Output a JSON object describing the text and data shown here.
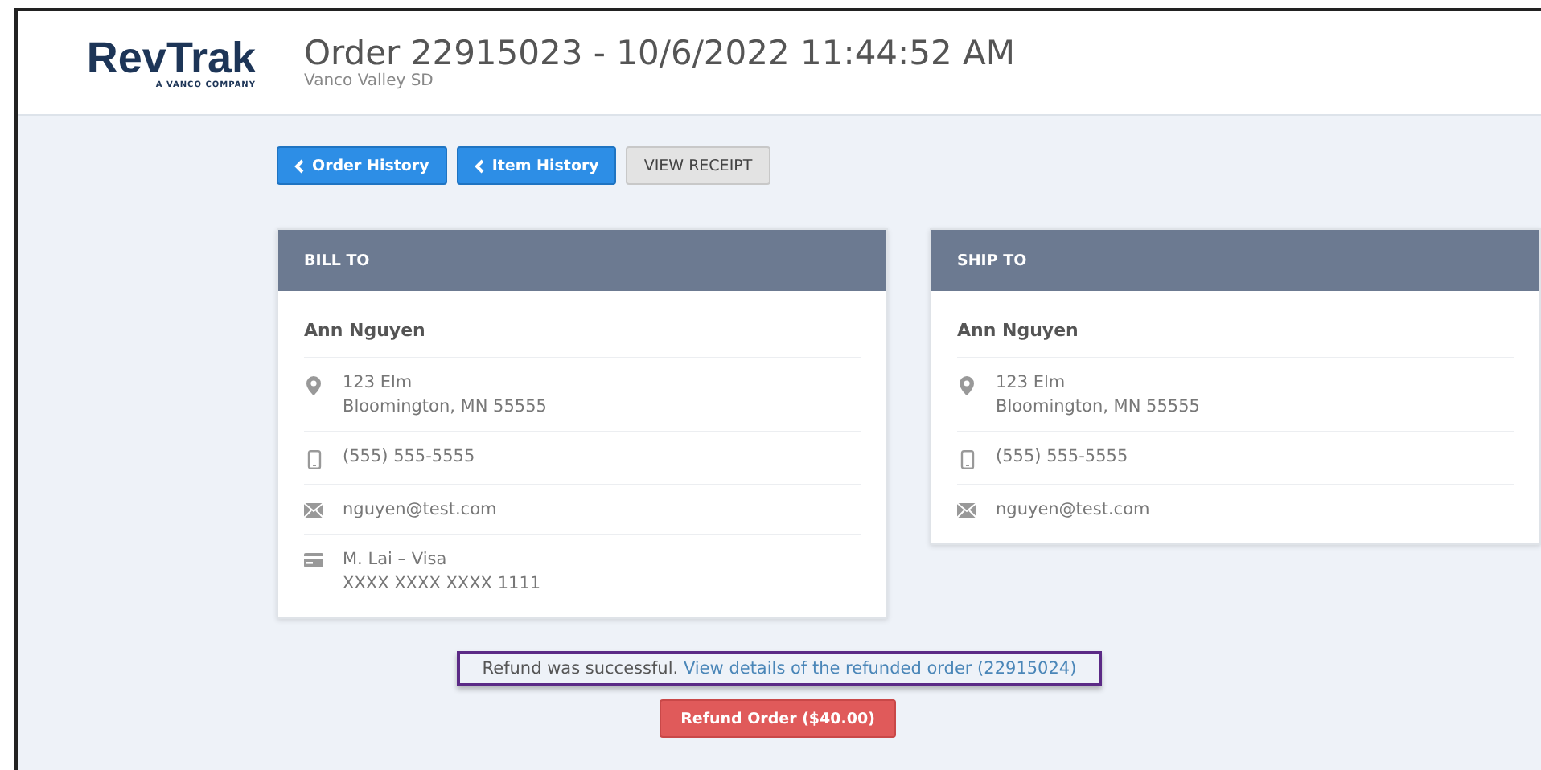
{
  "logo": {
    "name": "RevTrak",
    "tagline": "A VANCO COMPANY"
  },
  "header": {
    "title": "Order 22915023 - 10/6/2022 11:44:52 AM",
    "subtitle": "Vanco Valley SD"
  },
  "actions": [
    {
      "label": "Order History",
      "kind": "back"
    },
    {
      "label": "Item History",
      "kind": "back"
    },
    {
      "label": "VIEW RECEIPT",
      "kind": "plain"
    }
  ],
  "cards": [
    {
      "title": "BILL TO",
      "name": "Ann Nguyen",
      "rows": [
        {
          "kind": "address",
          "lines": [
            "123 Elm",
            "Bloomington, MN 55555"
          ]
        },
        {
          "kind": "phone",
          "lines": [
            "(555) 555-5555"
          ]
        },
        {
          "kind": "email",
          "lines": [
            "nguyen@test.com"
          ]
        },
        {
          "kind": "card",
          "lines": [
            "M. Lai – Visa",
            "XXXX XXXX XXXX 1111"
          ]
        }
      ]
    },
    {
      "title": "SHIP TO",
      "name": "Ann Nguyen",
      "rows": [
        {
          "kind": "address",
          "lines": [
            "123 Elm",
            "Bloomington, MN 55555"
          ]
        },
        {
          "kind": "phone",
          "lines": [
            "(555) 555-5555"
          ]
        },
        {
          "kind": "email",
          "lines": [
            "nguyen@test.com"
          ]
        }
      ]
    }
  ],
  "notice": {
    "text": "Refund was successful.",
    "link": "View details of the refunded order (22915024)"
  },
  "refund_button": "Refund Order ($40.00)"
}
